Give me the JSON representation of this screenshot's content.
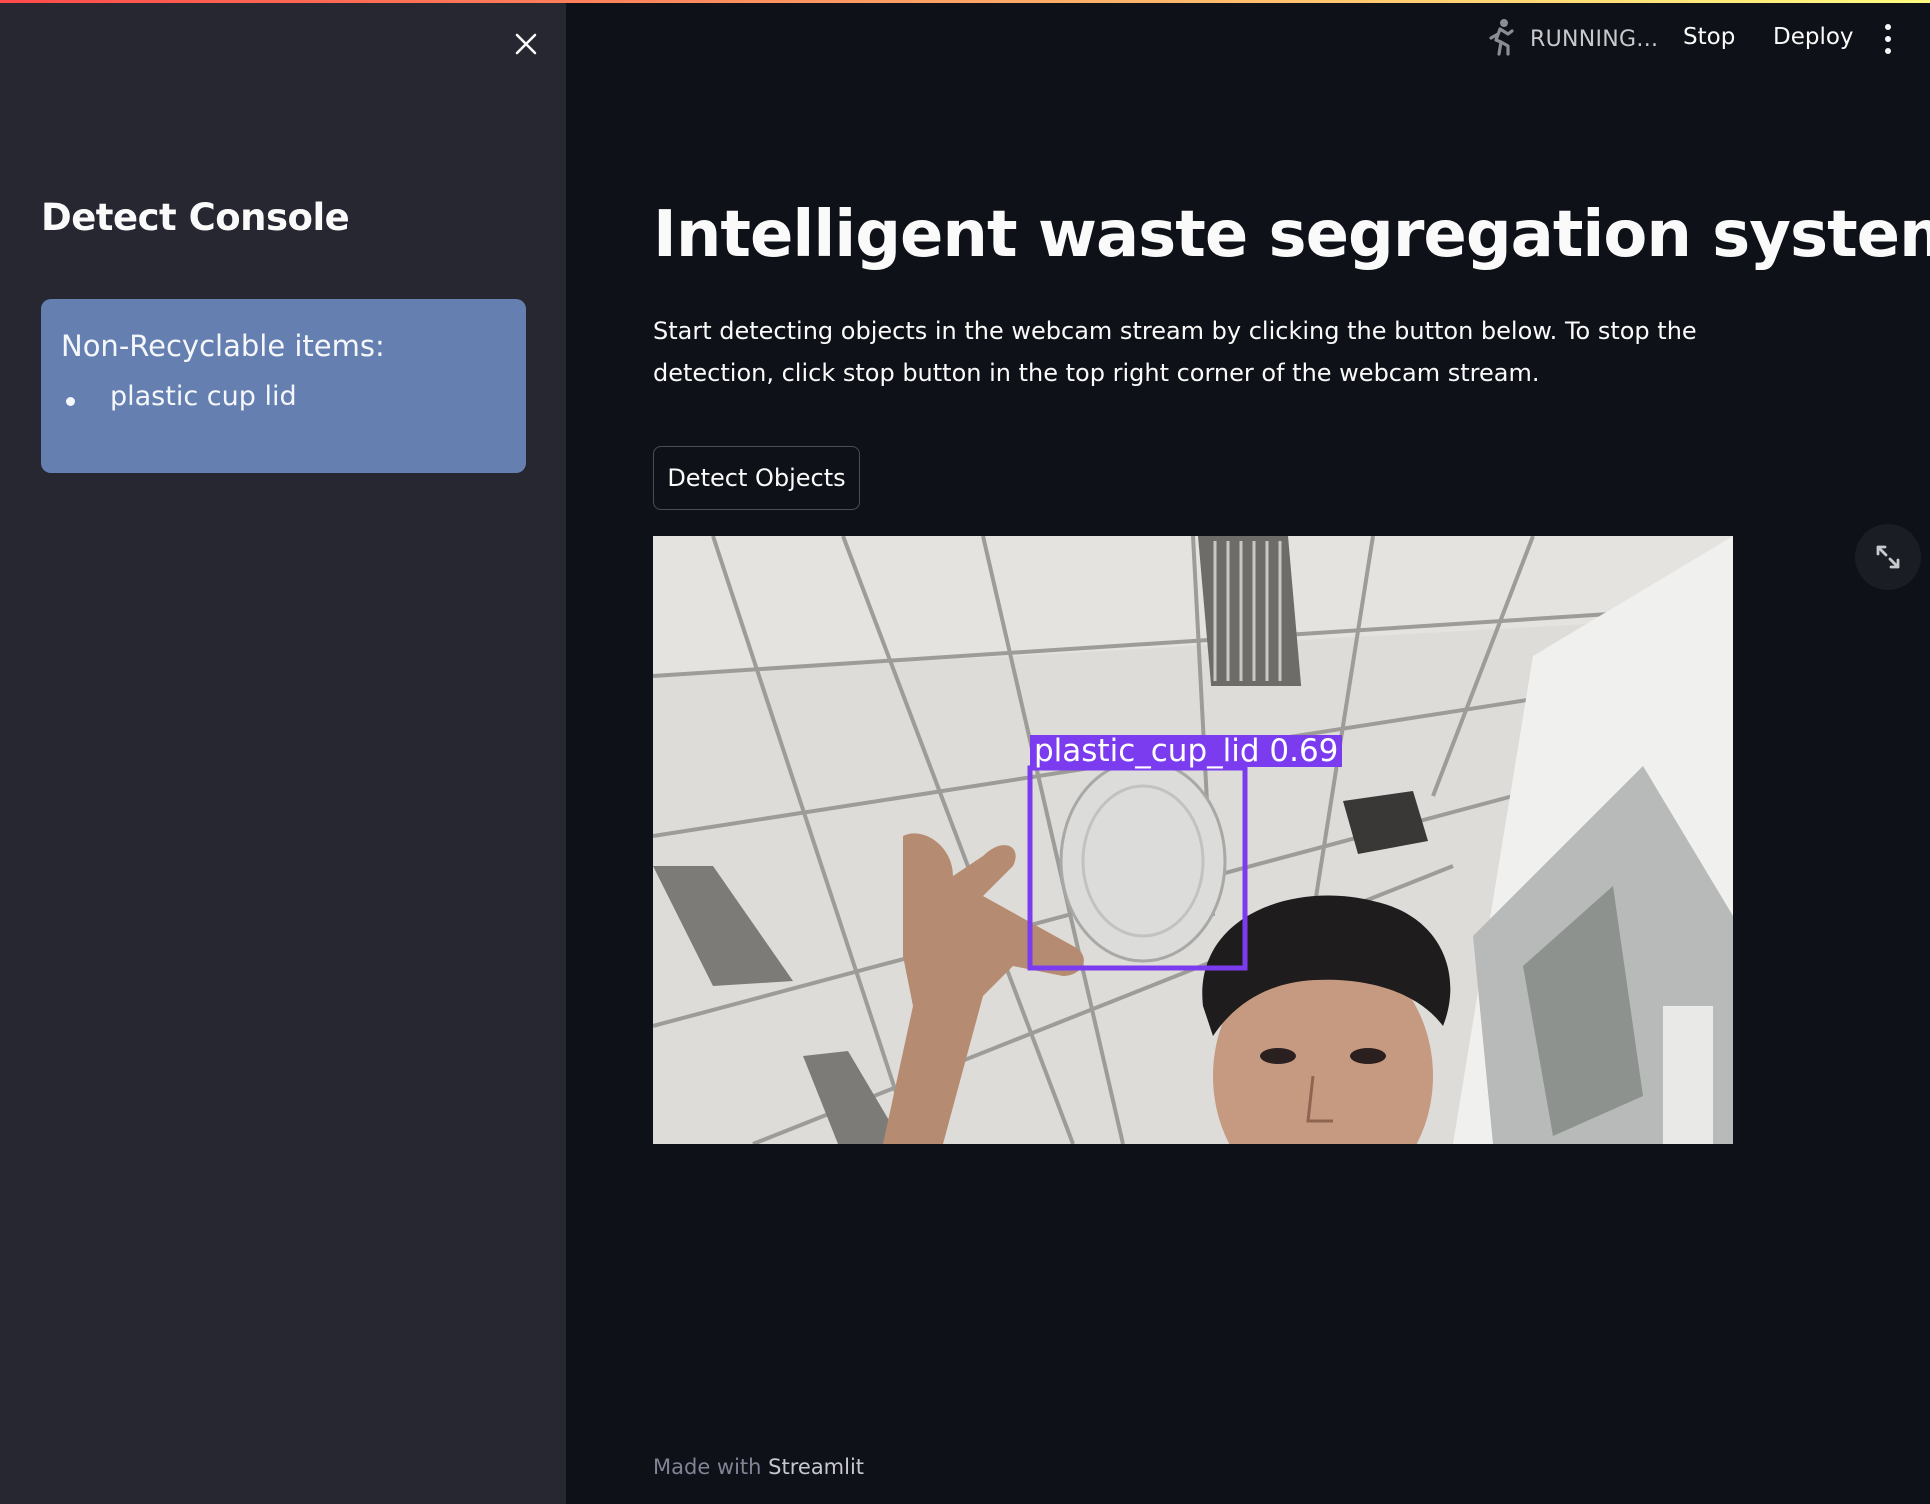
{
  "sidebar": {
    "close_icon": "close-icon",
    "title": "Detect Console",
    "info_box": {
      "heading": "Non-Recyclable items:",
      "items": [
        "plastic cup lid"
      ],
      "color": "#6580b0"
    }
  },
  "header": {
    "status_icon": "running-person-icon",
    "status_label": "RUNNING...",
    "stop_label": "Stop",
    "deploy_label": "Deploy",
    "menu_icon": "kebab-menu-icon"
  },
  "main": {
    "title": "Intelligent waste segregation system",
    "description": "Start detecting objects in the webcam stream by clicking the button below. To stop the detection, click stop button in the top right corner of the webcam stream.",
    "detect_button_label": "Detect Objects",
    "webcam": {
      "detection_label": "plastic_cup_lid 0.69",
      "box_color": "#7b3cf0"
    },
    "expand_icon": "fullscreen-expand-icon"
  },
  "footer": {
    "prefix": "Made with ",
    "brand": "Streamlit"
  },
  "colors": {
    "background": "#0e1117",
    "sidebar": "#262730",
    "accent_gradient_start": "#ff4b4b",
    "accent_gradient_end": "#fffd80"
  }
}
